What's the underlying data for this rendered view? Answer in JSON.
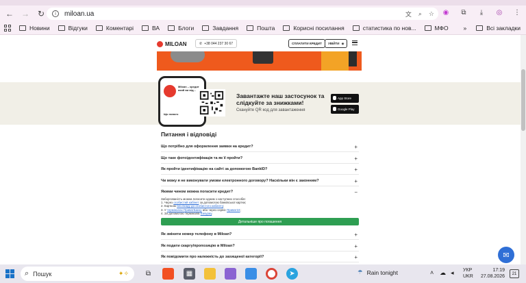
{
  "browser": {
    "url": "miloan.ua",
    "bookmarks": [
      "Новини",
      "Відгуки",
      "Коментарі",
      "ВА",
      "Блоги",
      "Завдання",
      "Пошта",
      "Корисні посилання",
      "статистика по нов...",
      "МФО"
    ],
    "all_bookmarks": "Всі закладки"
  },
  "site": {
    "logo": "MILOAN",
    "phone": "+38 044 237 30 67",
    "repay": "СПЛАТИТИ КРЕДИТ",
    "login": "УВІЙТИ"
  },
  "promo": {
    "title": "Завантажте наш застосунок та слідкуйте за знижками!",
    "subtitle": "Скануйте QR код для завантаження",
    "appstore": "App Store",
    "googleplay": "Google Play",
    "phone_text": "Miloan – кредит який ви від...",
    "phone_sub": "Що нового"
  },
  "faq": {
    "title": "Питання і відповіді",
    "items": [
      "Що потрібно для оформлення заявки на кредит?",
      "Що таке фотоідентифікація та як її пройти?",
      "Як пройти ідентифікацію на сайті за допомогою BankID?",
      "Чи можу я не виконувати умови електронного договору? Наскільки він є законним?",
      "Якими чином можна погасити кредит?",
      "Як змінити номер телефону в Miloan?",
      "Як подати скаргу/пропозицію в Miloan?",
      "Як повідомити про належність до захищеної категорії?"
    ],
    "answer_intro": "Заборгованість можна погасити одним з наступних способів:",
    "answer_1a": "1. Через ",
    "answer_1_link": "особистий кабінет",
    "answer_1b": " за допомогою банківської картки;",
    "answer_2a": "2. Карткою ",
    "answer_2_link": "без входу до особистого кабінету",
    "answer_2b": ";",
    "answer_3a": "3. У ",
    "answer_3_link1": "терміналах ПриватБанку",
    "answer_3b": " або через сервіс ",
    "answer_3_link2": "Приват24",
    "answer_3c": ";",
    "answer_4a": "4. За допомогою терміналів ",
    "answer_4_link": "Easypay",
    "answer_4b": ".",
    "details_button": "Детальніше про погашення"
  },
  "taskbar": {
    "search": "Пошук",
    "weather": "Rain tonight",
    "lang_top": "УКР",
    "lang_bottom": "UKR",
    "time": "17:19",
    "date": "27.08.2026",
    "notifications": "21"
  },
  "colors": {
    "brand_red": "#e63a2e",
    "banner_orange": "#ef5a1d",
    "button_green": "#2e9e52",
    "chat_blue": "#2f6fd6"
  }
}
